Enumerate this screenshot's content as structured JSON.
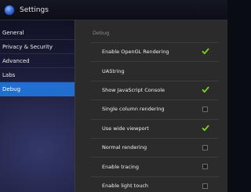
{
  "header": {
    "title": "Settings",
    "icon": "settings-app-icon"
  },
  "sidebar": {
    "items": [
      {
        "label": "General"
      },
      {
        "label": "Privacy & Security"
      },
      {
        "label": "Advanced"
      },
      {
        "label": "Labs"
      },
      {
        "label": "Debug",
        "active": true
      }
    ]
  },
  "panel": {
    "header": "Debug",
    "options": [
      {
        "label": "Enable OpenGL Rendering",
        "checked": true
      },
      {
        "label": "UAString",
        "checked": null
      },
      {
        "label": "Show JavaScript Console",
        "checked": true
      },
      {
        "label": "Single column rendering",
        "checked": false
      },
      {
        "label": "Use wide viewport",
        "checked": true
      },
      {
        "label": "Normal rendering",
        "checked": false
      },
      {
        "label": "Enable tracing",
        "checked": false
      },
      {
        "label": "Enable light touch",
        "checked": false
      }
    ]
  },
  "colors": {
    "accent": "#1e6fd0",
    "check": "#7ed321"
  }
}
